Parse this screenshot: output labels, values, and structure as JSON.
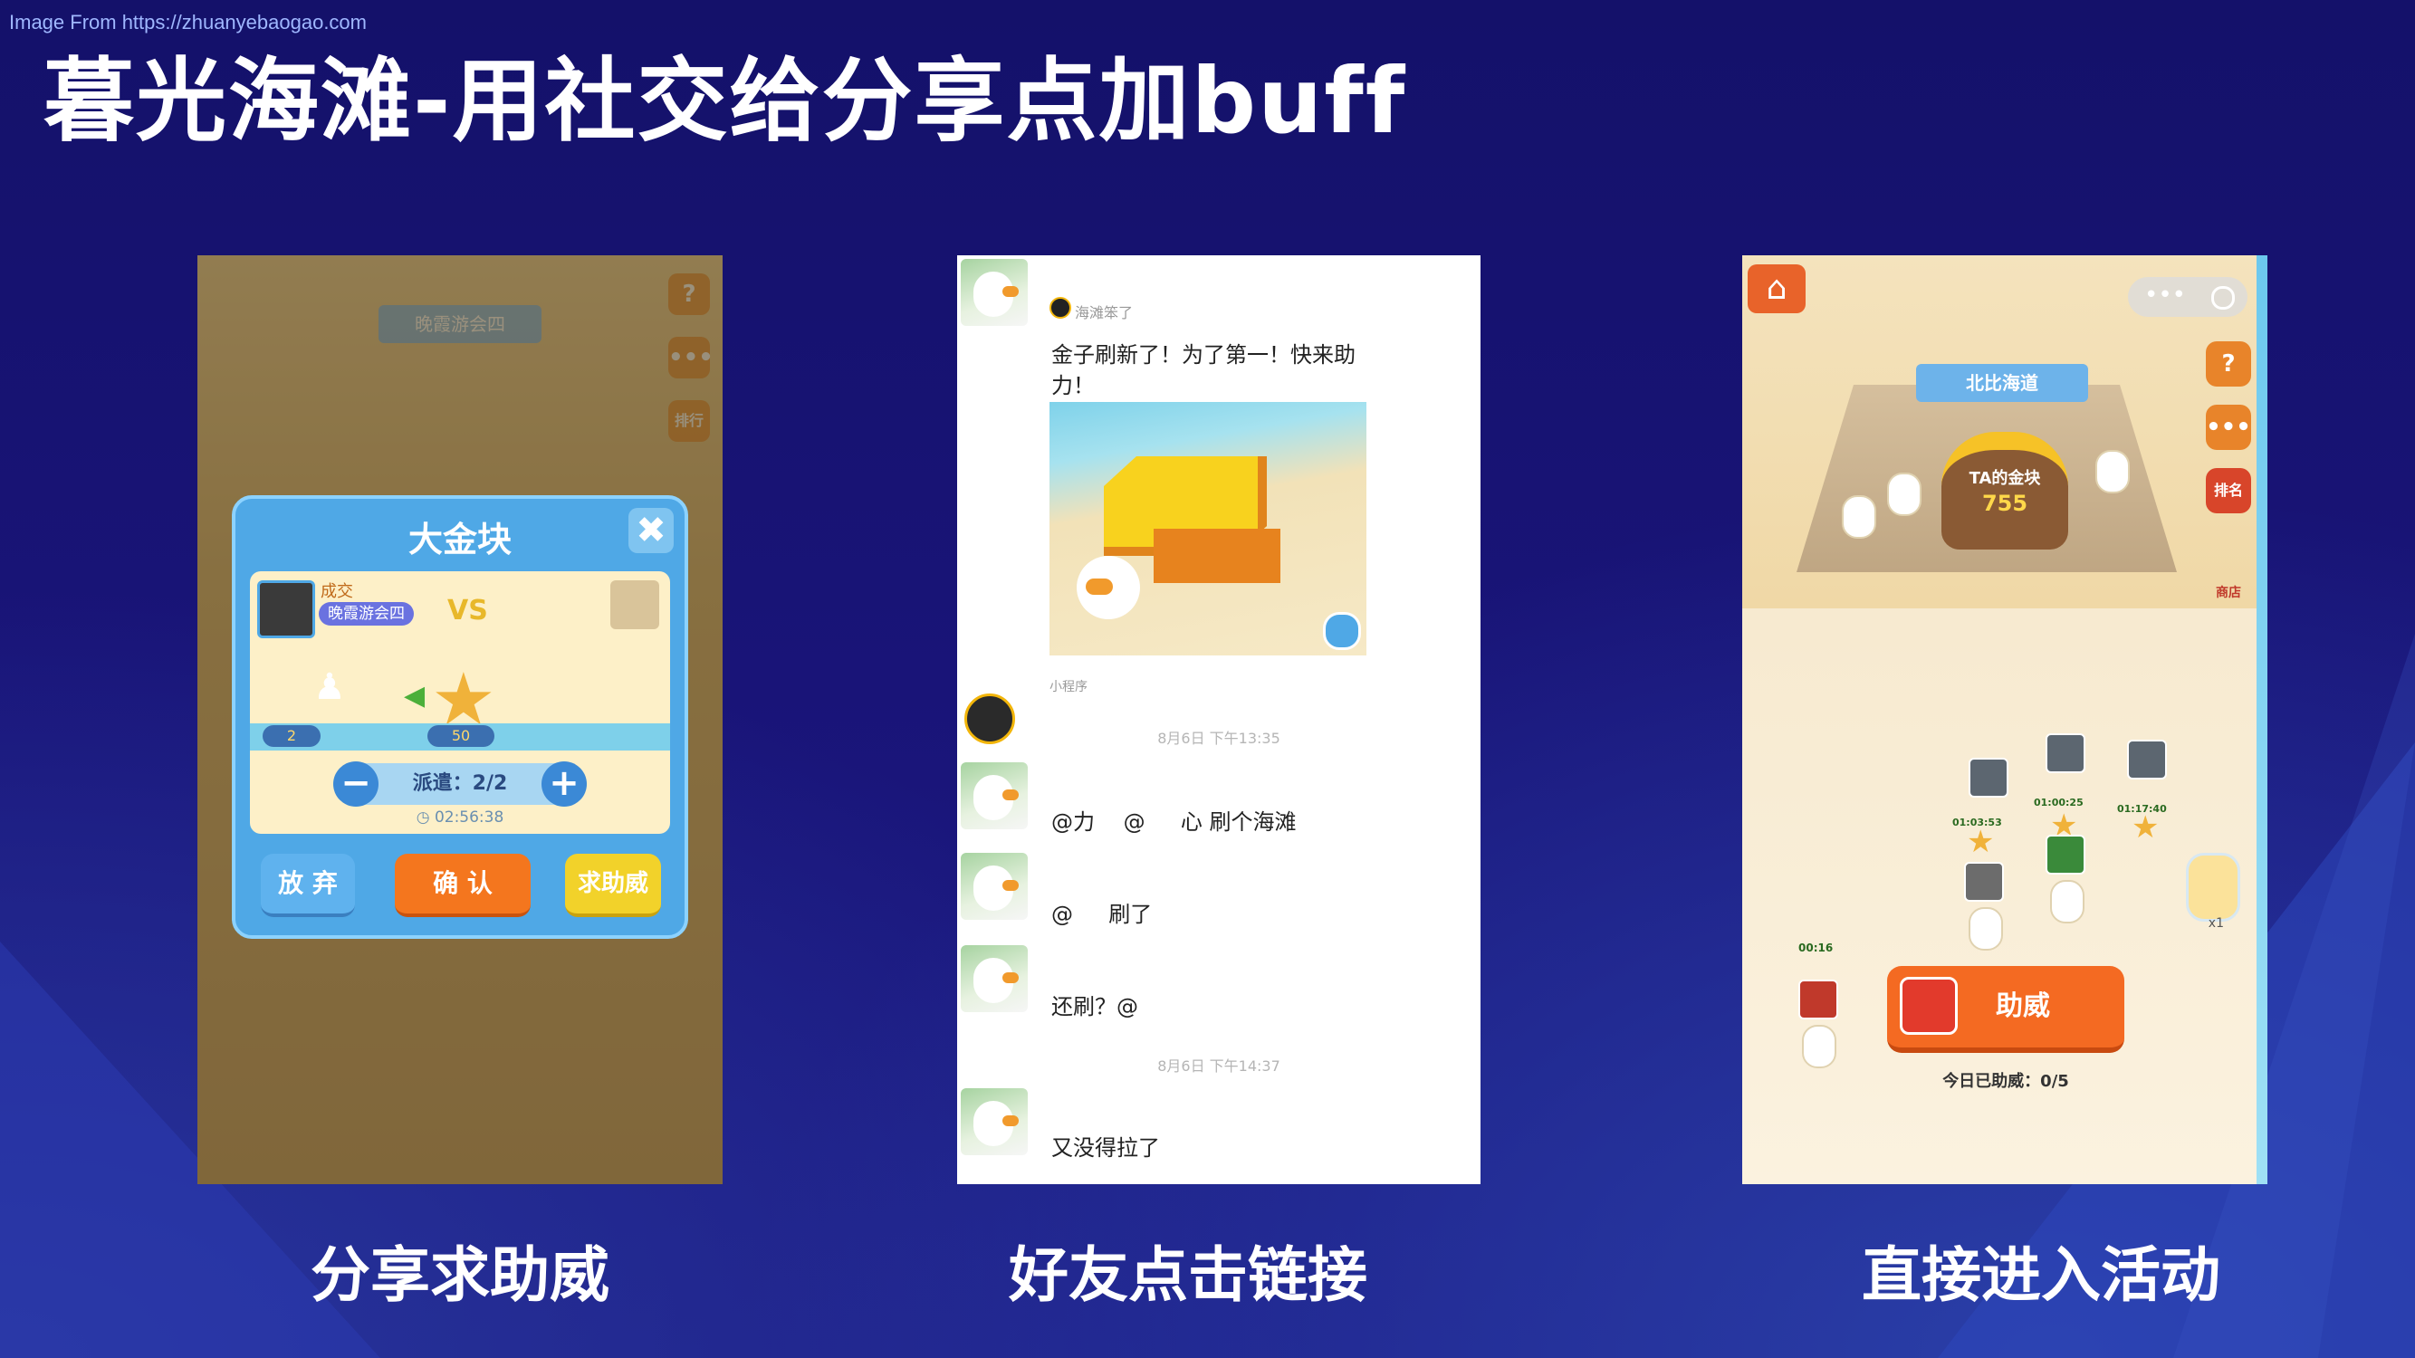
{
  "watermark": "Image From https://zhuanyebaogao.com",
  "title": "暮光海滩-用社交给分享点加buff",
  "panels": {
    "share": {
      "caption": "分享求助威",
      "bg_banner": "晚霞游会四",
      "bg_side_icons": [
        "?",
        "•••",
        "排行"
      ],
      "dialog": {
        "title": "大金块",
        "close_symbol": "✖",
        "player_name": "成交",
        "guild": "晚霞游会四",
        "vs_symbol": "VS",
        "left_count": "2",
        "mid_count": "50",
        "dispatch": "派遣：2/2",
        "minus": "−",
        "plus": "+",
        "timer": "◷ 02:56:38",
        "buttons": {
          "give_up": "放 弃",
          "confirm": "确 认",
          "help": "求助威"
        }
      }
    },
    "chat": {
      "caption": "好友点击链接",
      "card_source": "海滩笨了",
      "card_text_line1": "金子刷新了！为了第一！快来助",
      "card_text_line2": "力！",
      "mini_program": "小程序",
      "time1": "8月6日 下午13:35",
      "messages": [
        "@力　 @ 　 心  刷个海滩",
        "@ 　  刷了",
        "还刷？@ 　"
      ],
      "time2": "8月6日 下午14:37",
      "last_message": "又没得拉了"
    },
    "activity": {
      "caption": "直接进入活动",
      "banner": "北比海道",
      "pot_label": "TA的金块",
      "pot_value": "755",
      "side_icons": [
        "?",
        "•••",
        "排名"
      ],
      "side_icon_labels": [
        "",
        "",
        "排名"
      ],
      "npc_label": "商店",
      "slot_times": [
        "01:03:53",
        "01:00:25",
        "01:17:40"
      ],
      "left_unit_time": "00:16",
      "bottle_label": "x1",
      "help_button": "助威",
      "help_count": "今日已助威：0/5"
    }
  }
}
